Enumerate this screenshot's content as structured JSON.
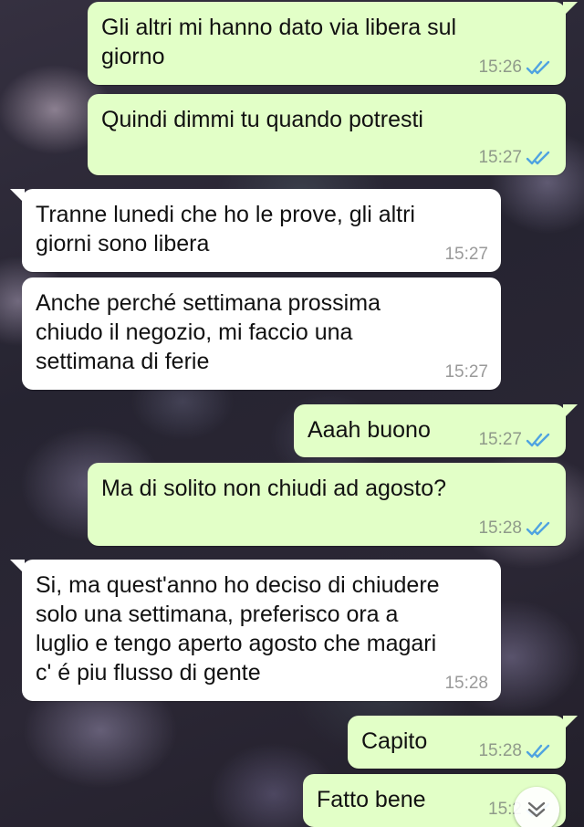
{
  "messages": [
    {
      "direction": "out",
      "text": "Gli altri mi hanno dato via libera sul\ngiorno",
      "time": "15:26",
      "read": true
    },
    {
      "direction": "out",
      "text": "Quindi dimmi tu quando potresti",
      "time": "15:27",
      "read": true
    },
    {
      "direction": "in",
      "text": "Tranne lunedi che ho le prove, gli altri\ngiorni sono libera",
      "time": "15:27"
    },
    {
      "direction": "in",
      "text": "Anche perché settimana prossima\nchiudo il negozio, mi faccio una\nsettimana di ferie",
      "time": "15:27"
    },
    {
      "direction": "out",
      "text": "Aaah buono",
      "time": "15:27",
      "read": true
    },
    {
      "direction": "out",
      "text": "Ma di solito non chiudi ad agosto?",
      "time": "15:28",
      "read": true
    },
    {
      "direction": "in",
      "text": "Si, ma quest'anno ho deciso di chiudere\nsolo una settimana, preferisco ora a\nluglio e tengo aperto agosto che magari\nc' é piu flusso di gente",
      "time": "15:28"
    },
    {
      "direction": "out",
      "text": "Capito",
      "time": "15:28",
      "read": true
    },
    {
      "direction": "out",
      "text": "Fatto bene",
      "time": "15:2",
      "read": true
    }
  ],
  "colors": {
    "outgoing_bubble": "#e2ffc7",
    "incoming_bubble": "#ffffff",
    "read_ticks": "#4fa3e0"
  },
  "icons": {
    "read_receipt": "double-check-icon",
    "scroll_down": "chevron-down-double-icon"
  }
}
